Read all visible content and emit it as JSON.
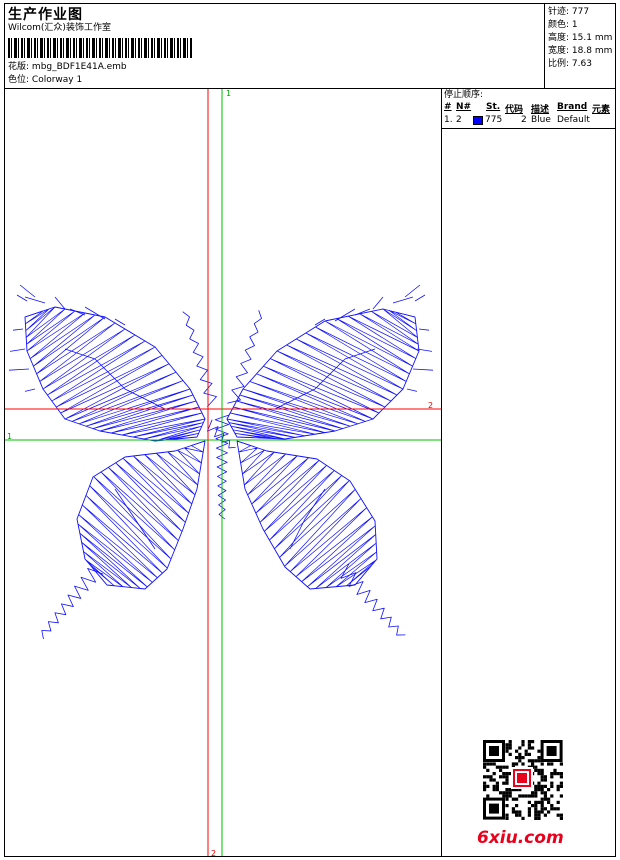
{
  "header": {
    "title": "生产作业图",
    "company": "Wilcom(汇众)装饰工作室",
    "design_label": "花版:",
    "design_file": "mbg_BDF1E41A.emb",
    "colorway_label": "色位:",
    "colorway": "Colorway 1"
  },
  "stats": [
    {
      "label": "针迹:",
      "value": "777"
    },
    {
      "label": "颜色:",
      "value": "1"
    },
    {
      "label": "高度:",
      "value": "15.1 mm"
    },
    {
      "label": "宽度:",
      "value": "18.8 mm"
    },
    {
      "label": "比例:",
      "value": "7.63"
    }
  ],
  "stop_sequence": {
    "title": "停止顺序:",
    "headers": [
      "#",
      "N#",
      "St.",
      "代码",
      "描述",
      "Brand",
      "元素"
    ],
    "rows": [
      {
        "index": "1.",
        "n": "2",
        "stitches": "775",
        "code": "2",
        "description": "Blue",
        "brand": "Default",
        "swatch_color": "#0000ff"
      }
    ]
  },
  "canvas": {
    "marker_top": "1",
    "marker_right": "2",
    "marker_left": "1",
    "marker_bottom": "2",
    "red_guide_color": "#ff0000",
    "green_guide_color": "#00c000",
    "thread_color": "#1010ff"
  },
  "watermark": {
    "text": "6xiu.com",
    "color": "#e8001c"
  }
}
